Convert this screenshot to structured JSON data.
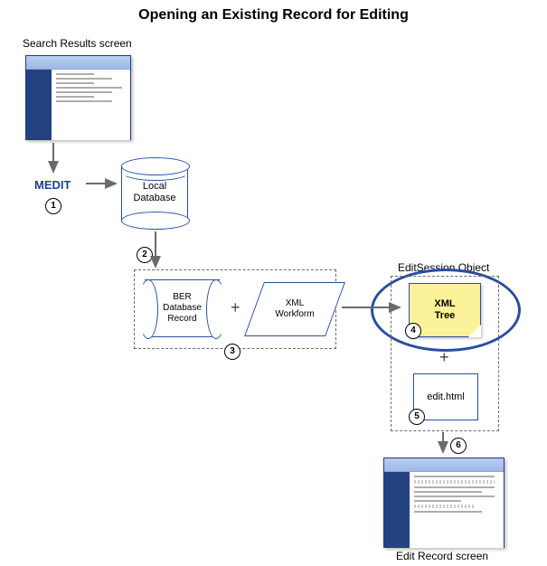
{
  "title": "Opening an Existing Record for Editing",
  "labels": {
    "search_results_screen": "Search Results screen",
    "medit": "MEDIT",
    "local_database": "Local\nDatabase",
    "ber_record": "BER\nDatabase\nRecord",
    "xml_workform": "XML\nWorkform",
    "edit_session_object": "EditSession Object",
    "xml_tree": "XML\nTree",
    "edit_html": "edit.html",
    "edit_record_screen": "Edit Record screen"
  },
  "steps": {
    "s1": "1",
    "s2": "2",
    "s3": "3",
    "s4": "4",
    "s5": "5",
    "s6": "6"
  },
  "symbols": {
    "plus": "+"
  }
}
